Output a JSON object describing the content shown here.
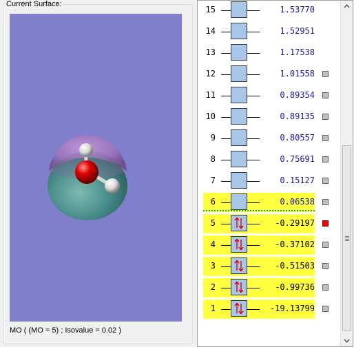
{
  "surface_panel": {
    "group_title": "Current Surface:",
    "caption": "MO ( (MO = 5) ; Isovalue = 0.02 )",
    "viewport_bg": "#7f7fcc"
  },
  "orbitals": [
    {
      "n": "15",
      "energy": "1.53770",
      "occupied": false,
      "highlight": false,
      "surface_marker": "none"
    },
    {
      "n": "14",
      "energy": "1.52951",
      "occupied": false,
      "highlight": false,
      "surface_marker": "none"
    },
    {
      "n": "13",
      "energy": "1.17538",
      "occupied": false,
      "highlight": false,
      "surface_marker": "none"
    },
    {
      "n": "12",
      "energy": "1.01558",
      "occupied": false,
      "highlight": false,
      "surface_marker": "gray"
    },
    {
      "n": "11",
      "energy": "0.89354",
      "occupied": false,
      "highlight": false,
      "surface_marker": "gray"
    },
    {
      "n": "10",
      "energy": "0.89135",
      "occupied": false,
      "highlight": false,
      "surface_marker": "gray"
    },
    {
      "n": "9",
      "energy": "0.80557",
      "occupied": false,
      "highlight": false,
      "surface_marker": "gray"
    },
    {
      "n": "8",
      "energy": "0.75691",
      "occupied": false,
      "highlight": false,
      "surface_marker": "gray"
    },
    {
      "n": "7",
      "energy": "0.15127",
      "occupied": false,
      "highlight": false,
      "surface_marker": "gray"
    },
    {
      "n": "6",
      "energy": "0.06538",
      "occupied": false,
      "highlight": true,
      "surface_marker": "gray"
    },
    {
      "n": "5",
      "energy": "-0.29197",
      "occupied": true,
      "highlight": true,
      "surface_marker": "red"
    },
    {
      "n": "4",
      "energy": "-0.37102",
      "occupied": true,
      "highlight": true,
      "surface_marker": "gray"
    },
    {
      "n": "3",
      "energy": "-0.51503",
      "occupied": true,
      "highlight": true,
      "surface_marker": "gray"
    },
    {
      "n": "2",
      "energy": "-0.99736",
      "occupied": true,
      "highlight": true,
      "surface_marker": "gray"
    },
    {
      "n": "1",
      "energy": "-19.13799",
      "occupied": true,
      "highlight": true,
      "surface_marker": "gray"
    }
  ],
  "colors": {
    "highlight": "#ffff40",
    "level_box": "#a8c6e8",
    "spin_arrow": "#e00000",
    "virtual_energy": "#1818a0",
    "homo_lumo_divider": "#00b050",
    "active_surface": "#ff0000"
  }
}
